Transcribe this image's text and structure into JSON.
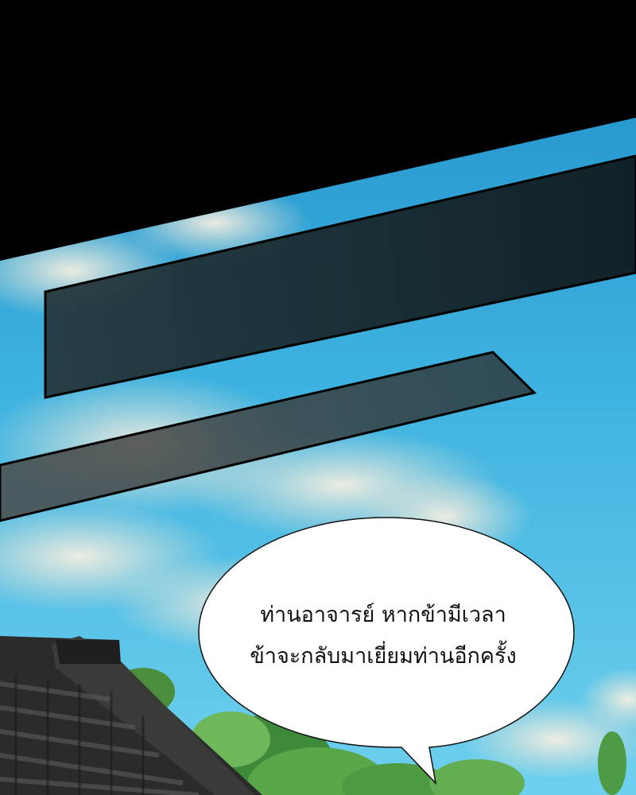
{
  "panel": {
    "sky_top_color": "#2aa0d6",
    "sky_bottom_color": "#5cc6e8",
    "speech_bubble": {
      "lines": [
        "ท่านอาจารย์ หากข้ามีเวลา",
        "ข้าจะกลับมาเยี่ยมท่านอีกครั้ง"
      ]
    }
  }
}
